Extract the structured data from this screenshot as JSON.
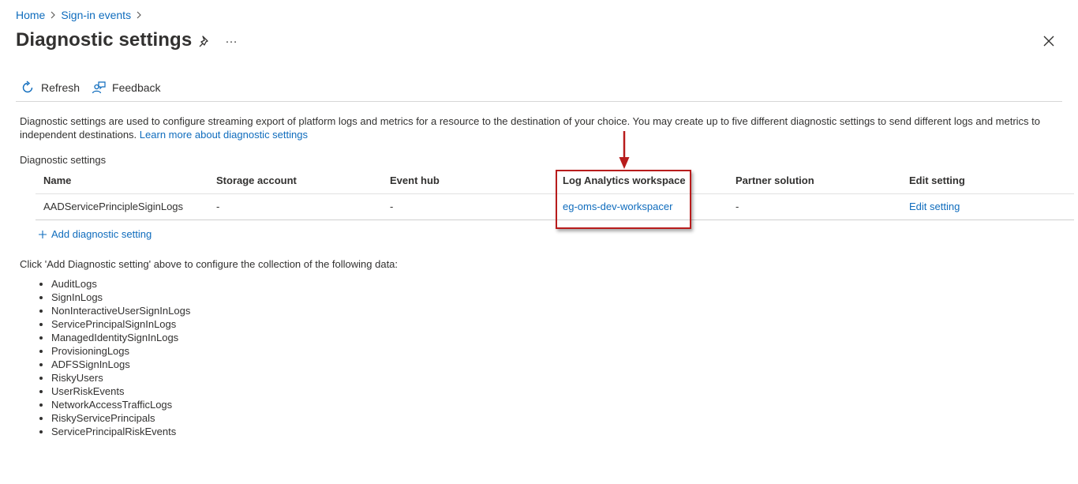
{
  "breadcrumb": {
    "home": "Home",
    "parent": "Sign-in events"
  },
  "title": "Diagnostic settings",
  "toolbar": {
    "refresh": "Refresh",
    "feedback": "Feedback"
  },
  "description": {
    "text": "Diagnostic settings are used to configure streaming export of platform logs and metrics for a resource to the destination of your choice. You may create up to five different diagnostic settings to send different logs and metrics to independent destinations. ",
    "link": "Learn more about diagnostic settings"
  },
  "section_label": "Diagnostic settings",
  "table": {
    "headers": [
      "Name",
      "Storage account",
      "Event hub",
      "Log Analytics workspace",
      "Partner solution",
      "Edit setting"
    ],
    "row": {
      "name": "AADServicePrincipleSiginLogs",
      "storage": "-",
      "eventhub": "-",
      "workspace": "eg-oms-dev-workspacer",
      "partner": "-",
      "edit": "Edit setting"
    }
  },
  "add_setting": "Add diagnostic setting",
  "note": "Click 'Add Diagnostic setting' above to configure the collection of the following data:",
  "data_items": [
    "AuditLogs",
    "SignInLogs",
    "NonInteractiveUserSignInLogs",
    "ServicePrincipalSignInLogs",
    "ManagedIdentitySignInLogs",
    "ProvisioningLogs",
    "ADFSSignInLogs",
    "RiskyUsers",
    "UserRiskEvents",
    "NetworkAccessTrafficLogs",
    "RiskyServicePrincipals",
    "ServicePrincipalRiskEvents"
  ],
  "icons": {
    "more": "…",
    "refresh": "refresh-icon",
    "feedback": "feedback-icon",
    "pin": "pin-icon",
    "close": "close-icon"
  },
  "colors": {
    "link": "#0f6cbd",
    "highlight": "#b81c1c",
    "text": "#323130"
  }
}
